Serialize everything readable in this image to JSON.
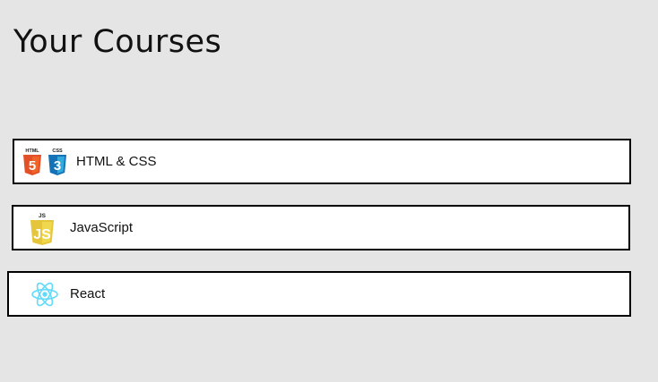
{
  "page": {
    "title": "Your Courses"
  },
  "courses": [
    {
      "label": "HTML & CSS",
      "icons": [
        {
          "name": "html5-icon",
          "caption": "HTML",
          "glyph": "5",
          "color": "#e34f26"
        },
        {
          "name": "css3-icon",
          "caption": "CSS",
          "glyph": "3",
          "color": "#1572b6"
        }
      ]
    },
    {
      "label": "JavaScript",
      "icons": [
        {
          "name": "javascript-icon",
          "caption": "JS",
          "glyph": "JS",
          "color": "#f0d84e"
        }
      ]
    },
    {
      "label": "React",
      "icons": [
        {
          "name": "react-icon",
          "color": "#61dafb"
        }
      ]
    }
  ],
  "colors": {
    "background": "#e5e5e5",
    "card_background": "#ffffff",
    "card_border": "#000000"
  }
}
